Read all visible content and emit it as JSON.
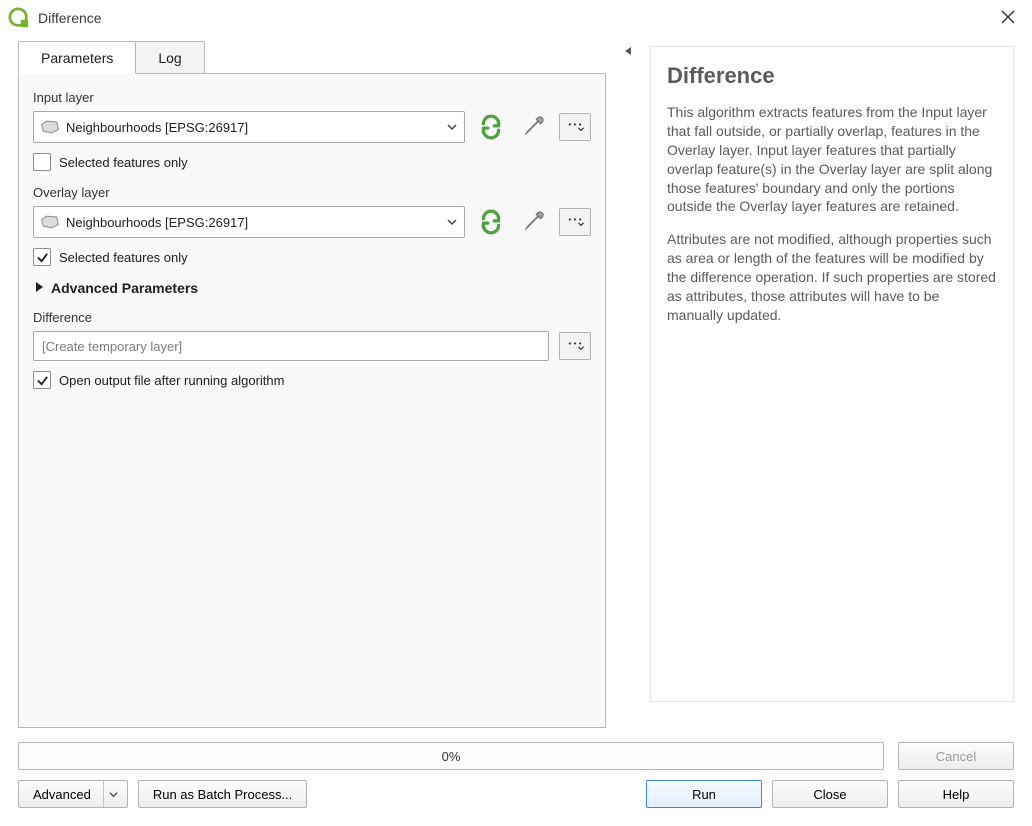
{
  "window": {
    "title": "Difference"
  },
  "tabs": {
    "parameters": "Parameters",
    "log": "Log"
  },
  "params": {
    "input_label": "Input layer",
    "input_value": "Neighbourhoods [EPSG:26917]",
    "input_selected_only": "Selected features only",
    "overlay_label": "Overlay layer",
    "overlay_value": "Neighbourhoods [EPSG:26917]",
    "overlay_selected_only": "Selected features only",
    "advanced": "Advanced Parameters",
    "output_label": "Difference",
    "output_placeholder": "[Create temporary layer]",
    "open_after": "Open output file after running algorithm"
  },
  "checks": {
    "input_selected": false,
    "overlay_selected": true,
    "open_after": true
  },
  "help": {
    "title": "Difference",
    "p1": "This algorithm extracts features from the Input layer that fall outside, or partially overlap, features in the Overlay layer. Input layer features that partially overlap feature(s) in the Overlay layer are split along those features' boundary and only the portions outside the Overlay layer features are retained.",
    "p2": "Attributes are not modified, although properties such as area or length of the features will be modified by the difference operation. If such properties are stored as attributes, those attributes will have to be manually updated."
  },
  "progress": "0%",
  "buttons": {
    "cancel": "Cancel",
    "advanced": "Advanced",
    "batch": "Run as Batch Process...",
    "run": "Run",
    "close": "Close",
    "help": "Help"
  }
}
